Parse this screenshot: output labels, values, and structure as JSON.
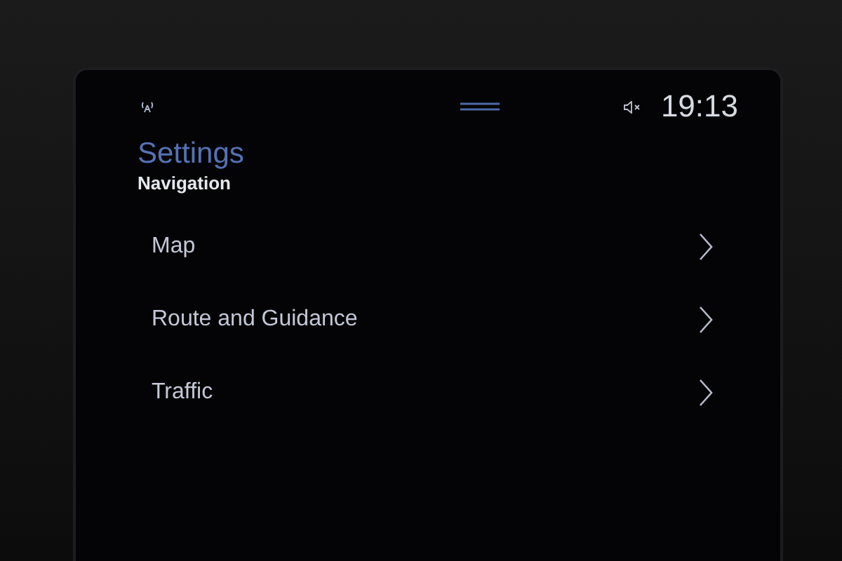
{
  "status_bar": {
    "time": "19:13"
  },
  "header": {
    "title": "Settings",
    "subtitle": "Navigation"
  },
  "menu_items": [
    {
      "label": "Map"
    },
    {
      "label": "Route and Guidance"
    },
    {
      "label": "Traffic"
    }
  ]
}
